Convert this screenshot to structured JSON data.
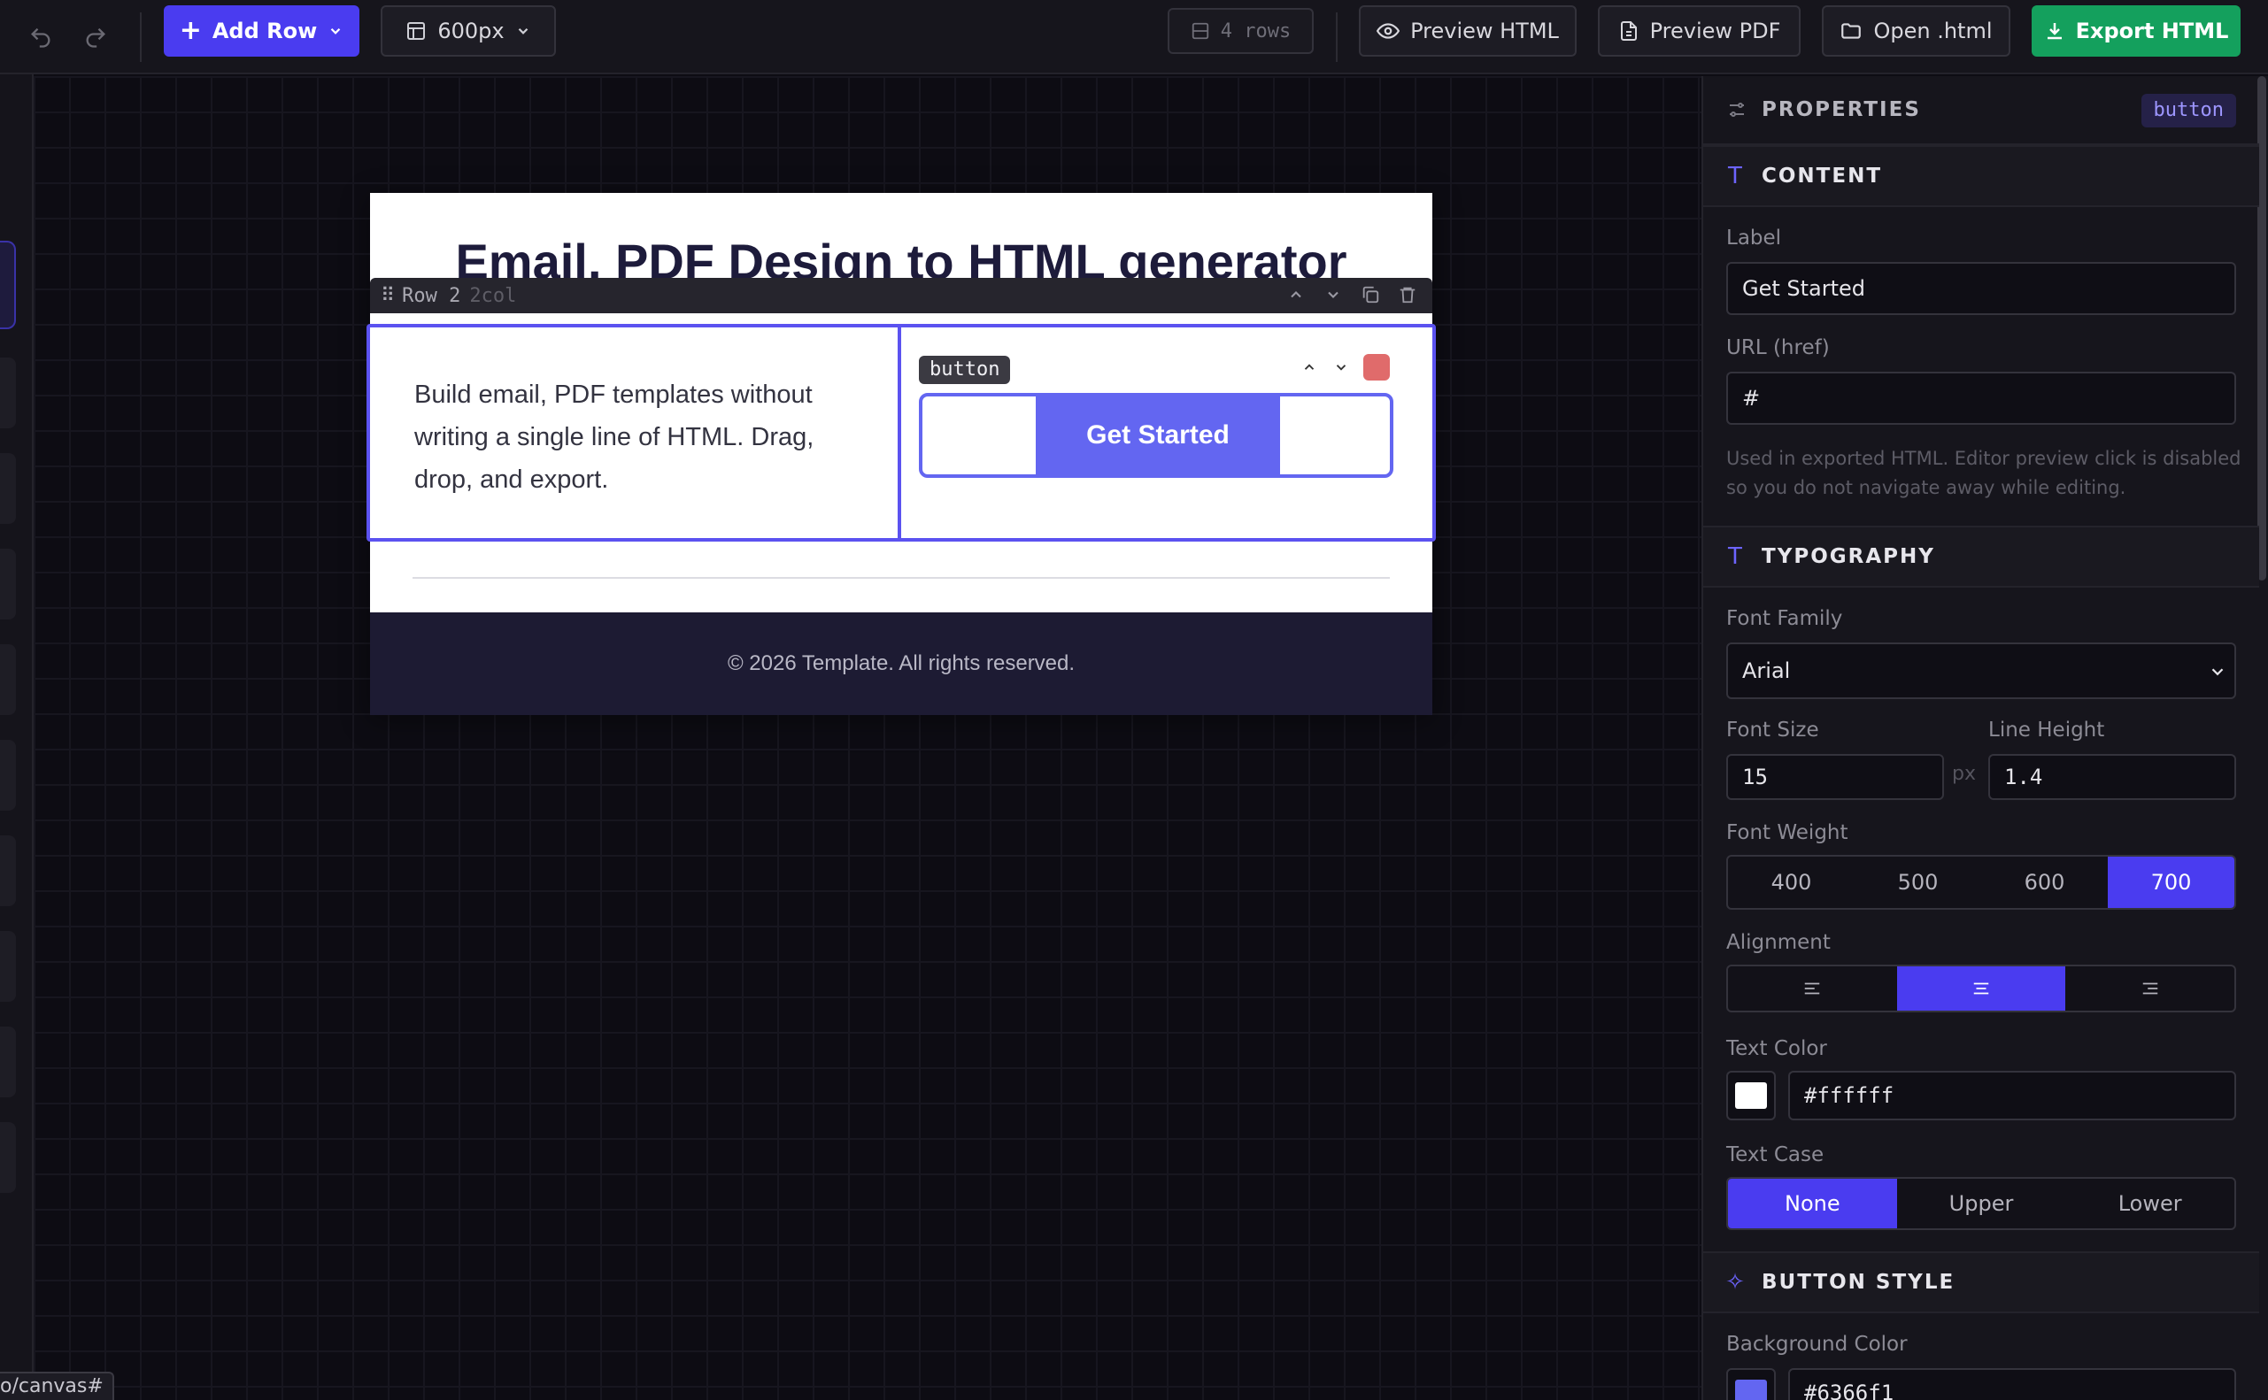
{
  "toolbar": {
    "add_row_label": "Add Row",
    "width_select": "600px",
    "rows_count": "4 rows",
    "preview_html": "Preview HTML",
    "preview_pdf": "Preview PDF",
    "open_html": "Open .html",
    "export_html": "Export HTML"
  },
  "canvas": {
    "heading": "Email, PDF Design to HTML generator",
    "row_label": "Row 2",
    "row_type": "2col",
    "body_text": "Build email, PDF templates without writing a single line of HTML. Drag, drop, and export.",
    "block_chip": "button",
    "button_label": "Get Started",
    "footer_text": "© 2026 Template. All rights reserved."
  },
  "panel": {
    "title": "PROPERTIES",
    "element_type": "button",
    "content": {
      "title": "CONTENT",
      "label_label": "Label",
      "label_value": "Get Started",
      "url_label": "URL (href)",
      "url_value": "#",
      "help": "Used in exported HTML. Editor preview click is disabled so you do not navigate away while editing."
    },
    "typography": {
      "title": "TYPOGRAPHY",
      "font_family_label": "Font Family",
      "font_family_value": "Arial",
      "font_size_label": "Font Size",
      "font_size_value": "15",
      "font_size_unit": "px",
      "line_height_label": "Line Height",
      "line_height_value": "1.4",
      "font_weight_label": "Font Weight",
      "font_weights": [
        "400",
        "500",
        "600",
        "700"
      ],
      "font_weight_selected": "700",
      "alignment_label": "Alignment",
      "alignment_selected": "center",
      "text_color_label": "Text Color",
      "text_color_value": "#ffffff",
      "text_case_label": "Text Case",
      "text_cases": [
        "None",
        "Upper",
        "Lower"
      ],
      "text_case_selected": "None"
    },
    "button_style": {
      "title": "BUTTON STYLE",
      "bg_color_label": "Background Color",
      "bg_color_value": "#6366f1"
    }
  },
  "status_url": "o/canvas#",
  "colors": {
    "accent": "#4a3cf0",
    "export": "#14a05d",
    "button_bg": "#6366f1",
    "footer_bg": "#1d1b33"
  }
}
